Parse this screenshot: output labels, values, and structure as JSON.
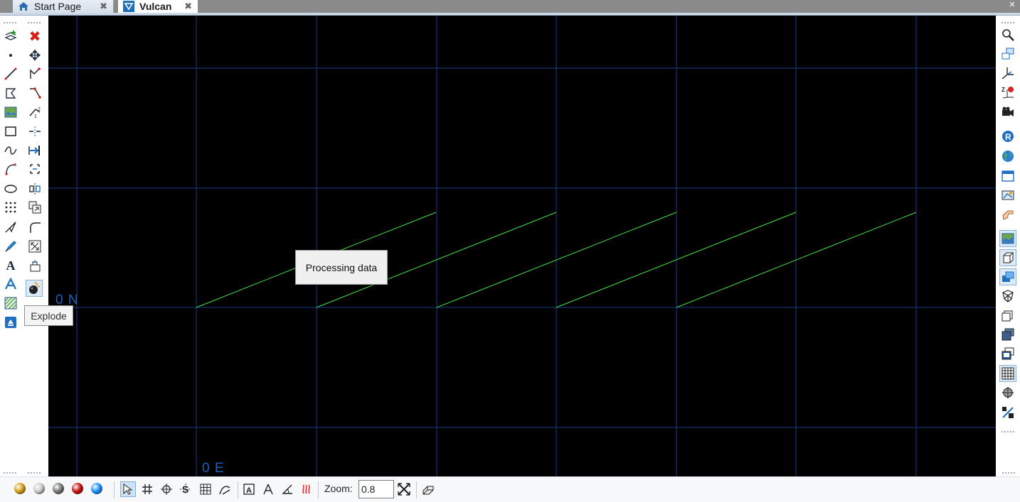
{
  "tabs": [
    {
      "label": "Start Page",
      "icon": "home-icon",
      "close": "✖"
    },
    {
      "label": "Vulcan",
      "icon": "vulcan-logo-icon",
      "close": "✖"
    }
  ],
  "viewport": {
    "background": "#000000",
    "grid_color": "#1a3a8a",
    "line_color": "#44e044",
    "axis_labels": {
      "north": "0 N",
      "east": "0 E"
    }
  },
  "popup": {
    "text": "Processing data"
  },
  "tooltip": {
    "text": "Explode"
  },
  "left_toolbar": {
    "col1": [
      "add-layer-icon",
      "point-icon",
      "line-icon",
      "polygon-icon",
      "image-icon",
      "rectangle-icon",
      "curve-icon",
      "arc-icon",
      "ellipse-icon",
      "point-grid-icon",
      "digitise-icon",
      "pen-icon",
      "text-icon",
      "3d-text-icon",
      "hatch-icon",
      "export-icon"
    ],
    "col2": [
      "delete-icon",
      "move-icon",
      "move-point-icon",
      "insert-point-icon",
      "renumber-icon",
      "split-icon",
      "extend-icon",
      "reverse-icon",
      "mirror-icon",
      "copy-icon",
      "fillet-icon",
      "scale-icon",
      "edit-attributes-icon",
      "explode-icon"
    ]
  },
  "right_toolbar": [
    "zoom-icon",
    "window-icon",
    "axes-icon",
    "z-axis-icon",
    "camera-icon",
    "r-icon",
    "globe-icon",
    "panel-icon",
    "print-icon",
    "hand-icon",
    "image-display-icon",
    "cube-icon",
    "layers-icon",
    "wireframe-icon",
    "sections-icon",
    "stack-icon",
    "overlay-icon",
    "grid-icon",
    "target-icon",
    "snap-icon"
  ],
  "bottom_toolbar": {
    "zoom_label": "Zoom:",
    "zoom_value": "0.8",
    "balls": [
      "#d4a017",
      "#c8c8c8",
      "#777777",
      "#cc1111",
      "#1e90ff"
    ]
  }
}
